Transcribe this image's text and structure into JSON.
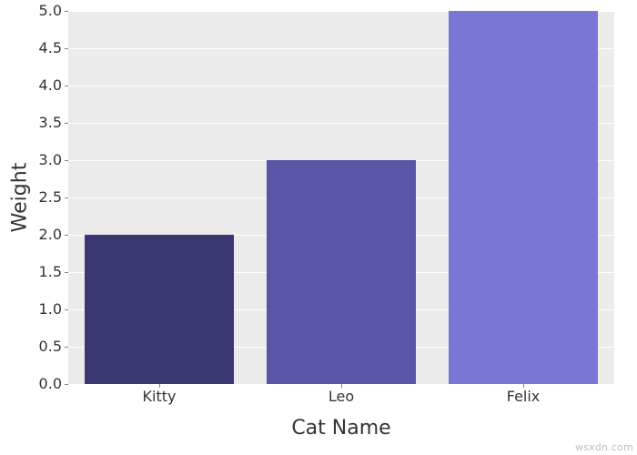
{
  "chart_data": {
    "type": "bar",
    "categories": [
      "Kitty",
      "Leo",
      "Felix"
    ],
    "values": [
      2.0,
      3.0,
      5.0
    ],
    "colors": [
      "#3b3773",
      "#5a55a8",
      "#7a76d6"
    ],
    "xlabel": "Cat Name",
    "ylabel": "Weight",
    "ylim": [
      0.0,
      5.0
    ],
    "y_ticks": [
      0.0,
      0.5,
      1.0,
      1.5,
      2.0,
      2.5,
      3.0,
      3.5,
      4.0,
      4.5,
      5.0
    ],
    "y_tick_labels": [
      "0.0",
      "0.5",
      "1.0",
      "1.5",
      "2.0",
      "2.5",
      "3.0",
      "3.5",
      "4.0",
      "4.5",
      "5.0"
    ],
    "title": ""
  },
  "watermark": "wsxdn.com"
}
